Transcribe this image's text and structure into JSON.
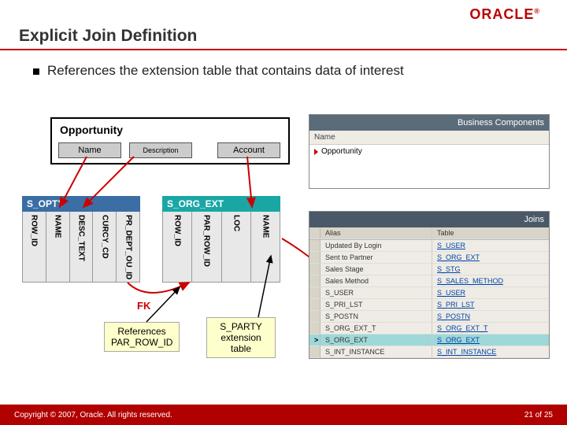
{
  "logo": "ORACLE",
  "title": "Explicit Join Definition",
  "bullet": "References the extension table that contains data of interest",
  "opportunity": {
    "label": "Opportunity",
    "fields": {
      "name": "Name",
      "desc": "Description",
      "account": "Account"
    }
  },
  "tables": {
    "opty": {
      "name": "S_OPTY",
      "cols": [
        "ROW_ID",
        "NAME",
        "DESC_TEXT",
        "CURCY_CD",
        "PR_DEPT_OU_ID"
      ]
    },
    "orgext": {
      "name": "S_ORG_EXT",
      "cols": [
        "ROW_ID",
        "PAR_ROW_ID",
        "LOC",
        "NAME"
      ]
    }
  },
  "fk_label": "FK",
  "callouts": {
    "ref": "References PAR_ROW_ID",
    "party": "S_PARTY extension table"
  },
  "bc_panel": {
    "title": "Business Components",
    "head": "Name",
    "row": "Opportunity"
  },
  "joins_panel": {
    "title": "Joins",
    "head": {
      "alias": "Alias",
      "table": "Table"
    },
    "rows": [
      {
        "alias": "Updated By Login",
        "table": "S_USER"
      },
      {
        "alias": "Sent to Partner",
        "table": "S_ORG_EXT"
      },
      {
        "alias": "Sales Stage",
        "table": "S_STG"
      },
      {
        "alias": "Sales Method",
        "table": "S_SALES_METHOD"
      },
      {
        "alias": "S_USER",
        "table": "S_USER"
      },
      {
        "alias": "S_PRI_LST",
        "table": "S_PRI_LST"
      },
      {
        "alias": "S_POSTN",
        "table": "S_POSTN"
      },
      {
        "alias": "S_ORG_EXT_T",
        "table": "S_ORG_EXT_T"
      },
      {
        "alias": "S_ORG_EXT",
        "table": "S_ORG_EXT",
        "selected": true
      },
      {
        "alias": "S_INT_INSTANCE",
        "table": "S_INT_INSTANCE"
      }
    ]
  },
  "footer": {
    "copyright": "Copyright © 2007, Oracle. All rights reserved.",
    "page_current": "21",
    "page_sep": " of ",
    "page_total": "25"
  }
}
